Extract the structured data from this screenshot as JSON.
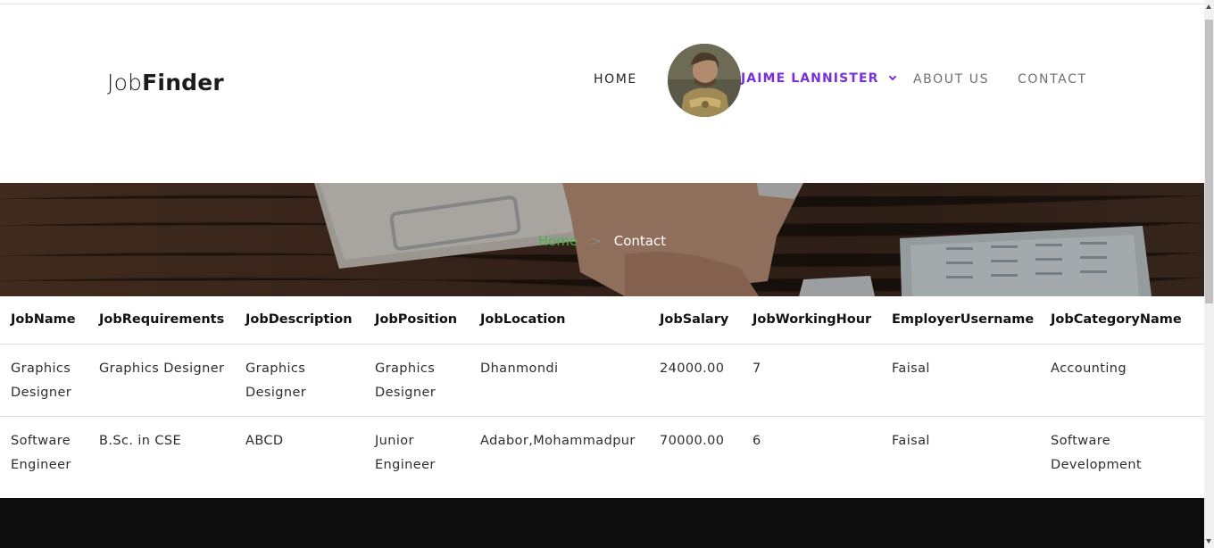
{
  "brand": {
    "part1": "Job",
    "part2": "Finder"
  },
  "nav": {
    "home": "HOME",
    "user": "JAIME LANNISTER",
    "about": "ABOUT US",
    "contact": "CONTACT"
  },
  "breadcrumb": {
    "home": "Home",
    "separator": ">",
    "current": "Contact"
  },
  "table": {
    "headers": [
      "JobName",
      "JobRequirements",
      "JobDescription",
      "JobPosition",
      "JobLocation",
      "JobSalary",
      "JobWorkingHour",
      "EmployerUsername",
      "JobCategoryName"
    ],
    "rows": [
      [
        "Graphics Designer",
        "Graphics Designer",
        "Graphics Designer",
        "Graphics Designer",
        "Dhanmondi",
        "24000.00",
        "7",
        "Faisal",
        "Accounting"
      ],
      [
        "Software Engineer",
        "B.Sc. in CSE",
        "ABCD",
        "Junior Engineer",
        "Adabor,Mohammadpur",
        "70000.00",
        "6",
        "Faisal",
        "Software Development"
      ]
    ]
  },
  "colors": {
    "accent": "#7a2fdc",
    "breadcrumb_home": "#47b34a",
    "footer": "#0d0d0d"
  },
  "icons": {
    "user_dropdown": "chevron-down-icon",
    "avatar": "user-avatar-image"
  }
}
